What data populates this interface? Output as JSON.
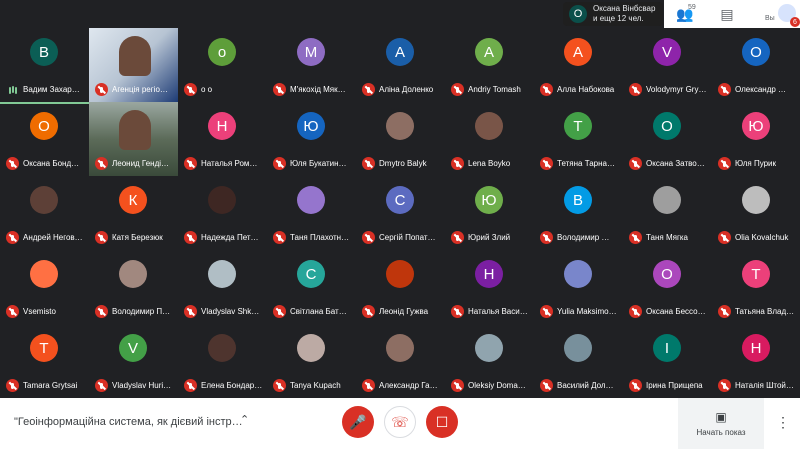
{
  "presenter": {
    "initial": "О",
    "name": "Оксана Вінбсвар",
    "others": "и еще 12 чел."
  },
  "topbar": {
    "participants_count": "59",
    "you_label": "Вы",
    "notification_count": "6"
  },
  "participants": [
    {
      "initial": "В",
      "name": "Вадим Захар…",
      "color": "#0b5e55",
      "speaking": true
    },
    {
      "initial": "",
      "name": "Агенція регіо…",
      "color": "#c9d3dc",
      "video": 1
    },
    {
      "initial": "о",
      "name": "о о",
      "color": "#5e9e3a"
    },
    {
      "initial": "М",
      "name": "М'якохід Мяк…",
      "color": "#8e6cc3"
    },
    {
      "initial": "А",
      "name": "Аліна Доленко",
      "color": "#1a5ea8"
    },
    {
      "initial": "А",
      "name": "Andriy Tomash",
      "color": "#6fae4b"
    },
    {
      "initial": "А",
      "name": "Алла Набокова",
      "color": "#f4511e"
    },
    {
      "initial": "V",
      "name": "Volodymyr Gry…",
      "color": "#8e24aa"
    },
    {
      "initial": "О",
      "name": "Олександр …",
      "color": "#1565c0"
    },
    {
      "initial": "О",
      "name": "Оксана Бонд…",
      "color": "#ef6c00"
    },
    {
      "initial": "",
      "name": "Леонид Генді…",
      "color": "#7b8b78",
      "video": 2
    },
    {
      "initial": "Н",
      "name": "Наталья Ром…",
      "color": "#ec407a"
    },
    {
      "initial": "Ю",
      "name": "Юля Букатин…",
      "color": "#1565c0"
    },
    {
      "initial": "",
      "name": "Dmytro Balyk",
      "color": "#8d6e63",
      "photo": true
    },
    {
      "initial": "",
      "name": "Lena Boyko",
      "color": "#795548",
      "photo": true
    },
    {
      "initial": "Т",
      "name": "Тетяна Тарна…",
      "color": "#43a047"
    },
    {
      "initial": "О",
      "name": "Оксана Затво…",
      "color": "#00796b"
    },
    {
      "initial": "Ю",
      "name": "Юля Пурик",
      "color": "#ec407a"
    },
    {
      "initial": "",
      "name": "Андрей Негов…",
      "color": "#5d4037",
      "photo": true
    },
    {
      "initial": "К",
      "name": "Катя Березюк",
      "color": "#f4511e"
    },
    {
      "initial": "",
      "name": "Надежда Пет…",
      "color": "#3e2723",
      "photo": true
    },
    {
      "initial": "",
      "name": "Таня Плахотн…",
      "color": "#9575cd",
      "photo": true
    },
    {
      "initial": "С",
      "name": "Сергій Попат…",
      "color": "#5c6bc0"
    },
    {
      "initial": "Ю",
      "name": "Юрий Злий",
      "color": "#6fae4b"
    },
    {
      "initial": "В",
      "name": "Володимир …",
      "color": "#039be5"
    },
    {
      "initial": "",
      "name": "Таня Мягка",
      "color": "#9e9e9e",
      "photo": true
    },
    {
      "initial": "",
      "name": "Olia Kovalchuk",
      "color": "#bdbdbd",
      "photo": true
    },
    {
      "initial": "",
      "name": "Vsemisto",
      "color": "#ff7043",
      "photo": true
    },
    {
      "initial": "",
      "name": "Володимир П…",
      "color": "#a1887f",
      "photo": true
    },
    {
      "initial": "",
      "name": "Vladyslav Shk…",
      "color": "#b0bec5",
      "photo": true
    },
    {
      "initial": "С",
      "name": "Світлана Бат…",
      "color": "#26a69a"
    },
    {
      "initial": "",
      "name": "Леонід Гужва",
      "color": "#bf360c",
      "photo": true
    },
    {
      "initial": "Н",
      "name": "Наталья Васи…",
      "color": "#7b1fa2"
    },
    {
      "initial": "",
      "name": "Yulia Maksimo…",
      "color": "#7986cb",
      "photo": true
    },
    {
      "initial": "О",
      "name": "Оксана Бессо…",
      "color": "#ab47bc"
    },
    {
      "initial": "Т",
      "name": "Татьяна Влад…",
      "color": "#ec407a"
    },
    {
      "initial": "Т",
      "name": "Tamara Grytsai",
      "color": "#f4511e"
    },
    {
      "initial": "V",
      "name": "Vladyslav Huri…",
      "color": "#43a047"
    },
    {
      "initial": "",
      "name": "Елена Бондар…",
      "color": "#4e342e",
      "photo": true
    },
    {
      "initial": "",
      "name": "Tanya Kupach",
      "color": "#bcaaa4",
      "photo": true
    },
    {
      "initial": "",
      "name": "Александр Га…",
      "color": "#8d6e63",
      "photo": true
    },
    {
      "initial": "",
      "name": "Oleksiy Doma…",
      "color": "#90a4ae",
      "photo": true
    },
    {
      "initial": "",
      "name": "Василий Дол…",
      "color": "#78909c",
      "photo": true
    },
    {
      "initial": "І",
      "name": "Ірина Прищепа",
      "color": "#00796b"
    },
    {
      "initial": "Н",
      "name": "Наталія Штой…",
      "color": "#d81b60"
    }
  ],
  "bottombar": {
    "meeting_title": "\"Геоінформаційна система, як дієвий інстр…",
    "present_label": "Начать показ"
  }
}
